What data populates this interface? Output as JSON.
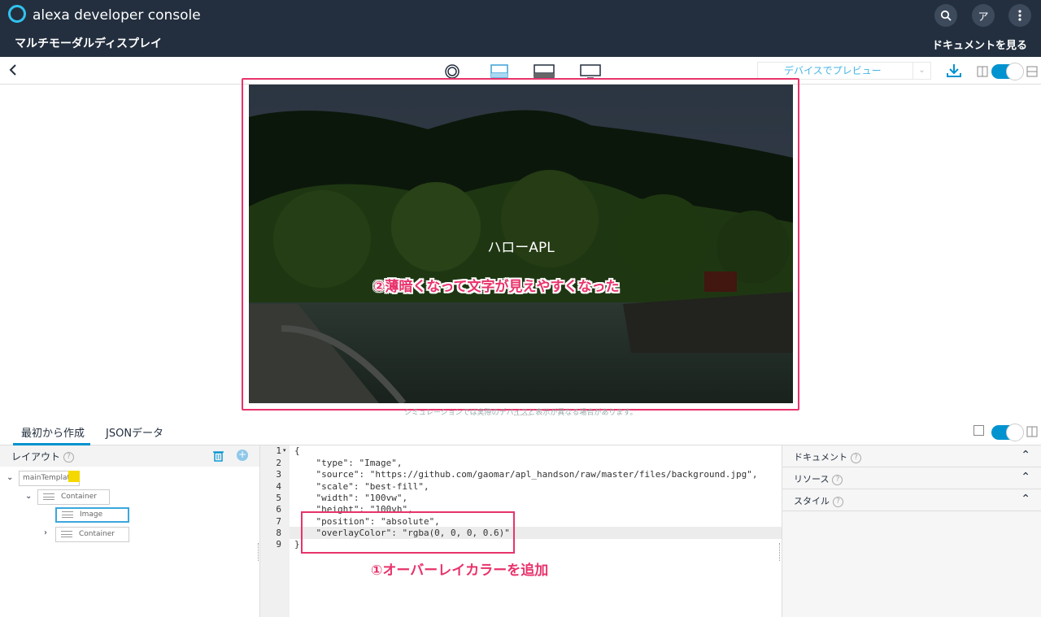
{
  "header": {
    "brand": "alexa developer console",
    "page_title": "マルチモーダルディスプレイ",
    "avatar_letter": "ア",
    "docs_link": "ドキュメントを見る"
  },
  "toolbar": {
    "preview_select": "デバイスでプレビュー",
    "device_icons": [
      "round-device-icon",
      "hub-device-icon",
      "landscape-device-icon",
      "tv-device-icon"
    ]
  },
  "preview": {
    "hello_text": "ハローAPL",
    "annotation": "②薄暗くなって文字が見えやすくなった",
    "simulation_note": "シミュレーションでは実際のデバイスと表示が異なる場合があります。"
  },
  "tabs": [
    {
      "label": "最初から作成",
      "active": true
    },
    {
      "label": "JSONデータ",
      "active": false
    }
  ],
  "layout_panel": {
    "title": "レイアウト",
    "tree": [
      {
        "label": "mainTemplate"
      },
      {
        "label": "Container"
      },
      {
        "label": "Image"
      },
      {
        "label": "Container"
      }
    ]
  },
  "editor": {
    "line_numbers": [
      "1",
      "2",
      "3",
      "4",
      "5",
      "6",
      "7",
      "8",
      "9"
    ],
    "lines": [
      "{",
      "    \"type\": \"Image\",",
      "    \"source\": \"https://github.com/gaomar/apl_handson/raw/master/files/background.jpg\",",
      "    \"scale\": \"best-fill\",",
      "    \"width\": \"100vw\",",
      "    \"height\": \"100vh\",",
      "    \"position\": \"absolute\",",
      "    \"overlayColor\": \"rgba(0, 0, 0, 0.6)\"",
      "}"
    ],
    "annotation": "①オーバーレイカラーを追加"
  },
  "right_panel": {
    "sections": [
      "ドキュメント",
      "リソース",
      "スタイル"
    ]
  },
  "colors": {
    "header_bg": "#232f3e",
    "accent": "#0093d0",
    "annotation": "#e8336b"
  }
}
